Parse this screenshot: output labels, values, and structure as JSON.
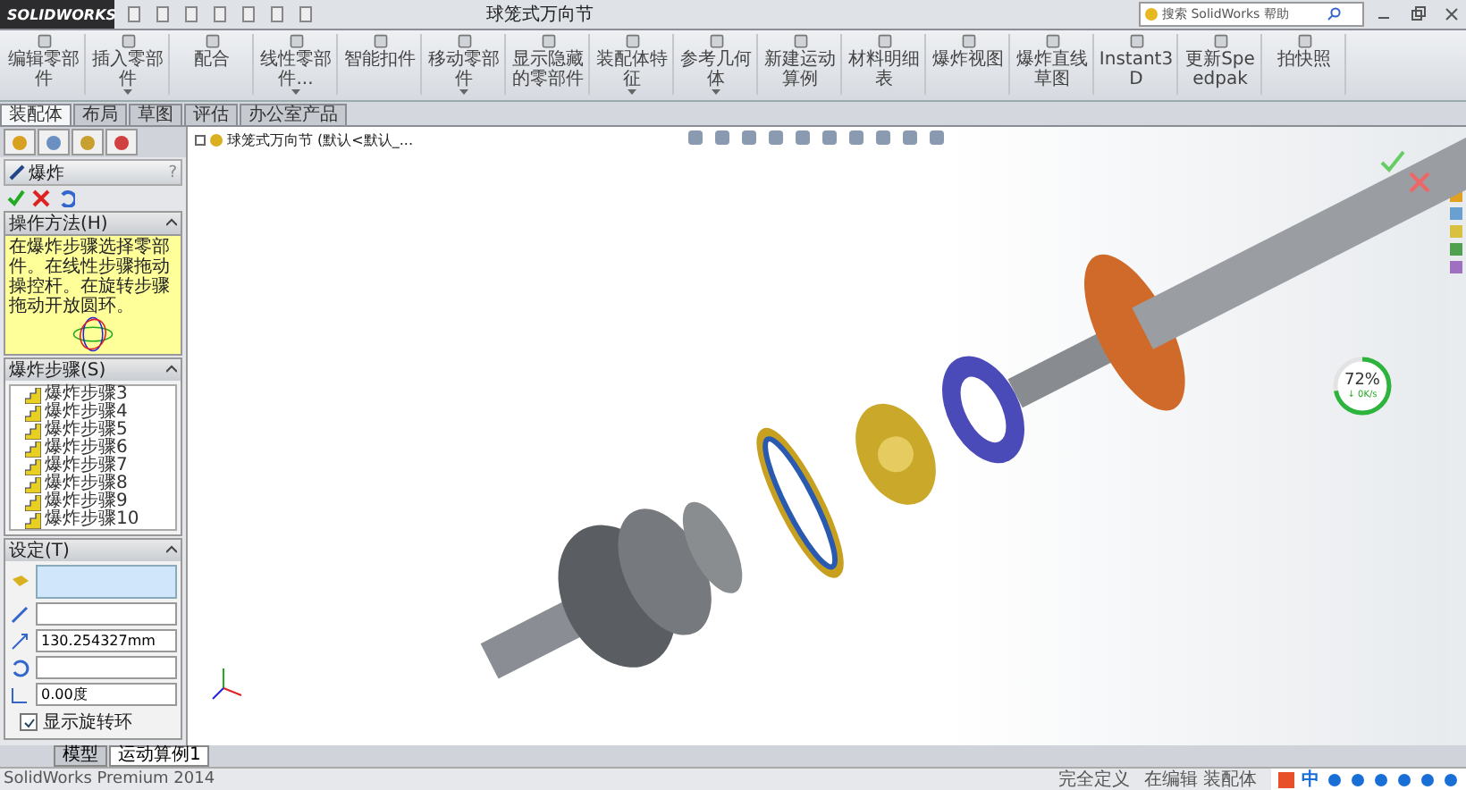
{
  "title_bar": {
    "logo": "SOLIDWORKS",
    "document_title": "球笼式万向节",
    "search": {
      "placeholder": "搜索 SolidWorks 帮助"
    }
  },
  "ribbon": [
    {
      "label": "编辑零部件",
      "dropdown": false
    },
    {
      "label": "插入零部件",
      "dropdown": true
    },
    {
      "label": "配合",
      "dropdown": false
    },
    {
      "label": "线性零部件...",
      "dropdown": true
    },
    {
      "label": "智能扣件",
      "dropdown": false
    },
    {
      "label": "移动零部件",
      "dropdown": true
    },
    {
      "label": "显示隐藏的零部件",
      "dropdown": false
    },
    {
      "label": "装配体特征",
      "dropdown": true
    },
    {
      "label": "参考几何体",
      "dropdown": true
    },
    {
      "label": "新建运动算例",
      "dropdown": false
    },
    {
      "label": "材料明细表",
      "dropdown": false
    },
    {
      "label": "爆炸视图",
      "dropdown": false
    },
    {
      "label": "爆炸直线草图",
      "dropdown": false
    },
    {
      "label": "Instant3D",
      "dropdown": false
    },
    {
      "label": "更新Speedpak",
      "dropdown": false
    },
    {
      "label": "拍快照",
      "dropdown": false
    }
  ],
  "tabs": [
    {
      "label": "装配体",
      "selected": true
    },
    {
      "label": "布局",
      "selected": false
    },
    {
      "label": "草图",
      "selected": false
    },
    {
      "label": "评估",
      "selected": false
    },
    {
      "label": "办公室产品",
      "selected": false
    }
  ],
  "property_manager": {
    "title": "爆炸",
    "help": "?",
    "how_to": {
      "header": "操作方法(H)",
      "text": "在爆炸步骤选择零部件。在线性步骤拖动操控杆。在旋转步骤拖动开放圆环。"
    },
    "steps": {
      "header": "爆炸步骤(S)",
      "items": [
        "爆炸步骤3",
        "爆炸步骤4",
        "爆炸步骤5",
        "爆炸步骤6",
        "爆炸步骤7",
        "爆炸步骤8",
        "爆炸步骤9",
        "爆炸步骤10"
      ]
    },
    "settings": {
      "header": "设定(T)",
      "distance": "130.254327mm",
      "angle": "0.00度",
      "show_rotation_ring": {
        "label": "显示旋转环",
        "checked": true
      }
    }
  },
  "tree": {
    "label": "球笼式万向节 (默认<默认_..."
  },
  "speed_meter": {
    "percent": "72%",
    "rate": "↓ 0K/s",
    "level": 0.72
  },
  "bottom_tabs": [
    {
      "label": "模型",
      "selected": false
    },
    {
      "label": "运动算例1",
      "selected": true
    }
  ],
  "status_bar": {
    "product": "SolidWorks Premium 2014",
    "state": "完全定义",
    "mode": "在编辑 装配体"
  },
  "tray": {
    "ime": "中"
  }
}
